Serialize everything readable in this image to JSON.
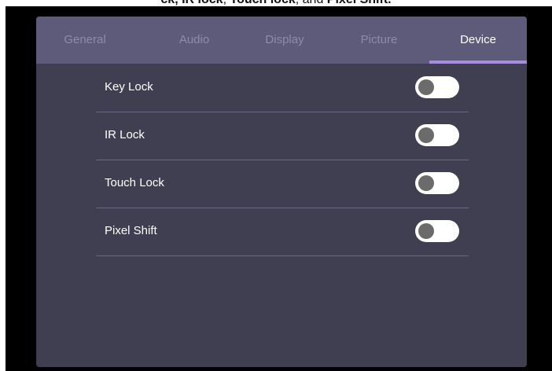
{
  "caption": {
    "prefix": "ck,",
    "ir_lock": "IR lock",
    "sep1": ",",
    "touch_lock": "Touch lock",
    "sep2": ", and",
    "pixel_shift": "Pixel Shift."
  },
  "tabs": [
    {
      "label": "General",
      "active": false
    },
    {
      "label": "Audio",
      "active": false
    },
    {
      "label": "Display",
      "active": false
    },
    {
      "label": "Picture",
      "active": false
    },
    {
      "label": "Device",
      "active": true
    }
  ],
  "settings": [
    {
      "label": "Key Lock",
      "state": "off"
    },
    {
      "label": "IR Lock",
      "state": "off"
    },
    {
      "label": "Touch Lock",
      "state": "off"
    },
    {
      "label": "Pixel Shift",
      "state": "off"
    }
  ],
  "colors": {
    "panel_bg": "#403f52",
    "tabbar_bg": "#5e5b7a",
    "active_tab_indicator": "#a88ae0",
    "toggle_track": "#ffffff",
    "toggle_knob": "#6b6b6b"
  }
}
